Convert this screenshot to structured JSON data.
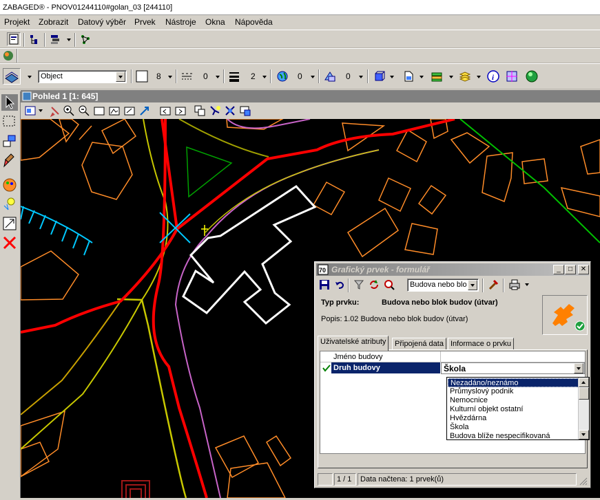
{
  "app": {
    "title": "ZABAGED® - PNOV01244110#golan_03 [244110]"
  },
  "menu": [
    "Projekt",
    "Zobrazit",
    "Datový výběr",
    "Prvek",
    "Nástroje",
    "Okna",
    "Nápověda"
  ],
  "toolbar": {
    "object_combo": "Object",
    "color_value": "8",
    "style_value": "0",
    "weight_value": "2",
    "transparency_value": "0",
    "priority_value": "0"
  },
  "view": {
    "title": "Pohled 1 [1: 645]"
  },
  "dialog": {
    "title": "Grafický prvek - formulář",
    "feature_combo": "Budova nebo blo",
    "type_label": "Typ prvku:",
    "type_value": "Budova nebo blok budov (útvar)",
    "desc_label": "Popis:",
    "desc_value": "1.02 Budova nebo blok budov (útvar)",
    "tabs": [
      "Uživatelské atributy",
      "Připojená data",
      "Informace o prvku"
    ],
    "active_tab": 0,
    "attributes": [
      {
        "name": "Jméno budovy",
        "value": ""
      },
      {
        "name": "Druh budovy",
        "value": "Škola"
      }
    ],
    "options": [
      "Nezadáno/neznámo",
      "Průmyslový podnik",
      "Nemocnice",
      "Kulturní objekt ostatní",
      "Hvězdárna",
      "Škola",
      "Budova blíže nespecifikovaná"
    ],
    "selected_option": "Nezadáno/neznámo",
    "status_page": "1 / 1",
    "status_text": "Data načtena: 1 prvek(ů)"
  },
  "colors": {
    "road_red": "#ff0000",
    "road_yellow": "#c8c800",
    "building_orange": "#ff8c28",
    "selected_white": "#ffffff",
    "magenta_line": "#c864c8",
    "cyan_hatch": "#00c8ff",
    "green_line": "#00c800",
    "dialog_icon_orange": "#ff8000"
  }
}
